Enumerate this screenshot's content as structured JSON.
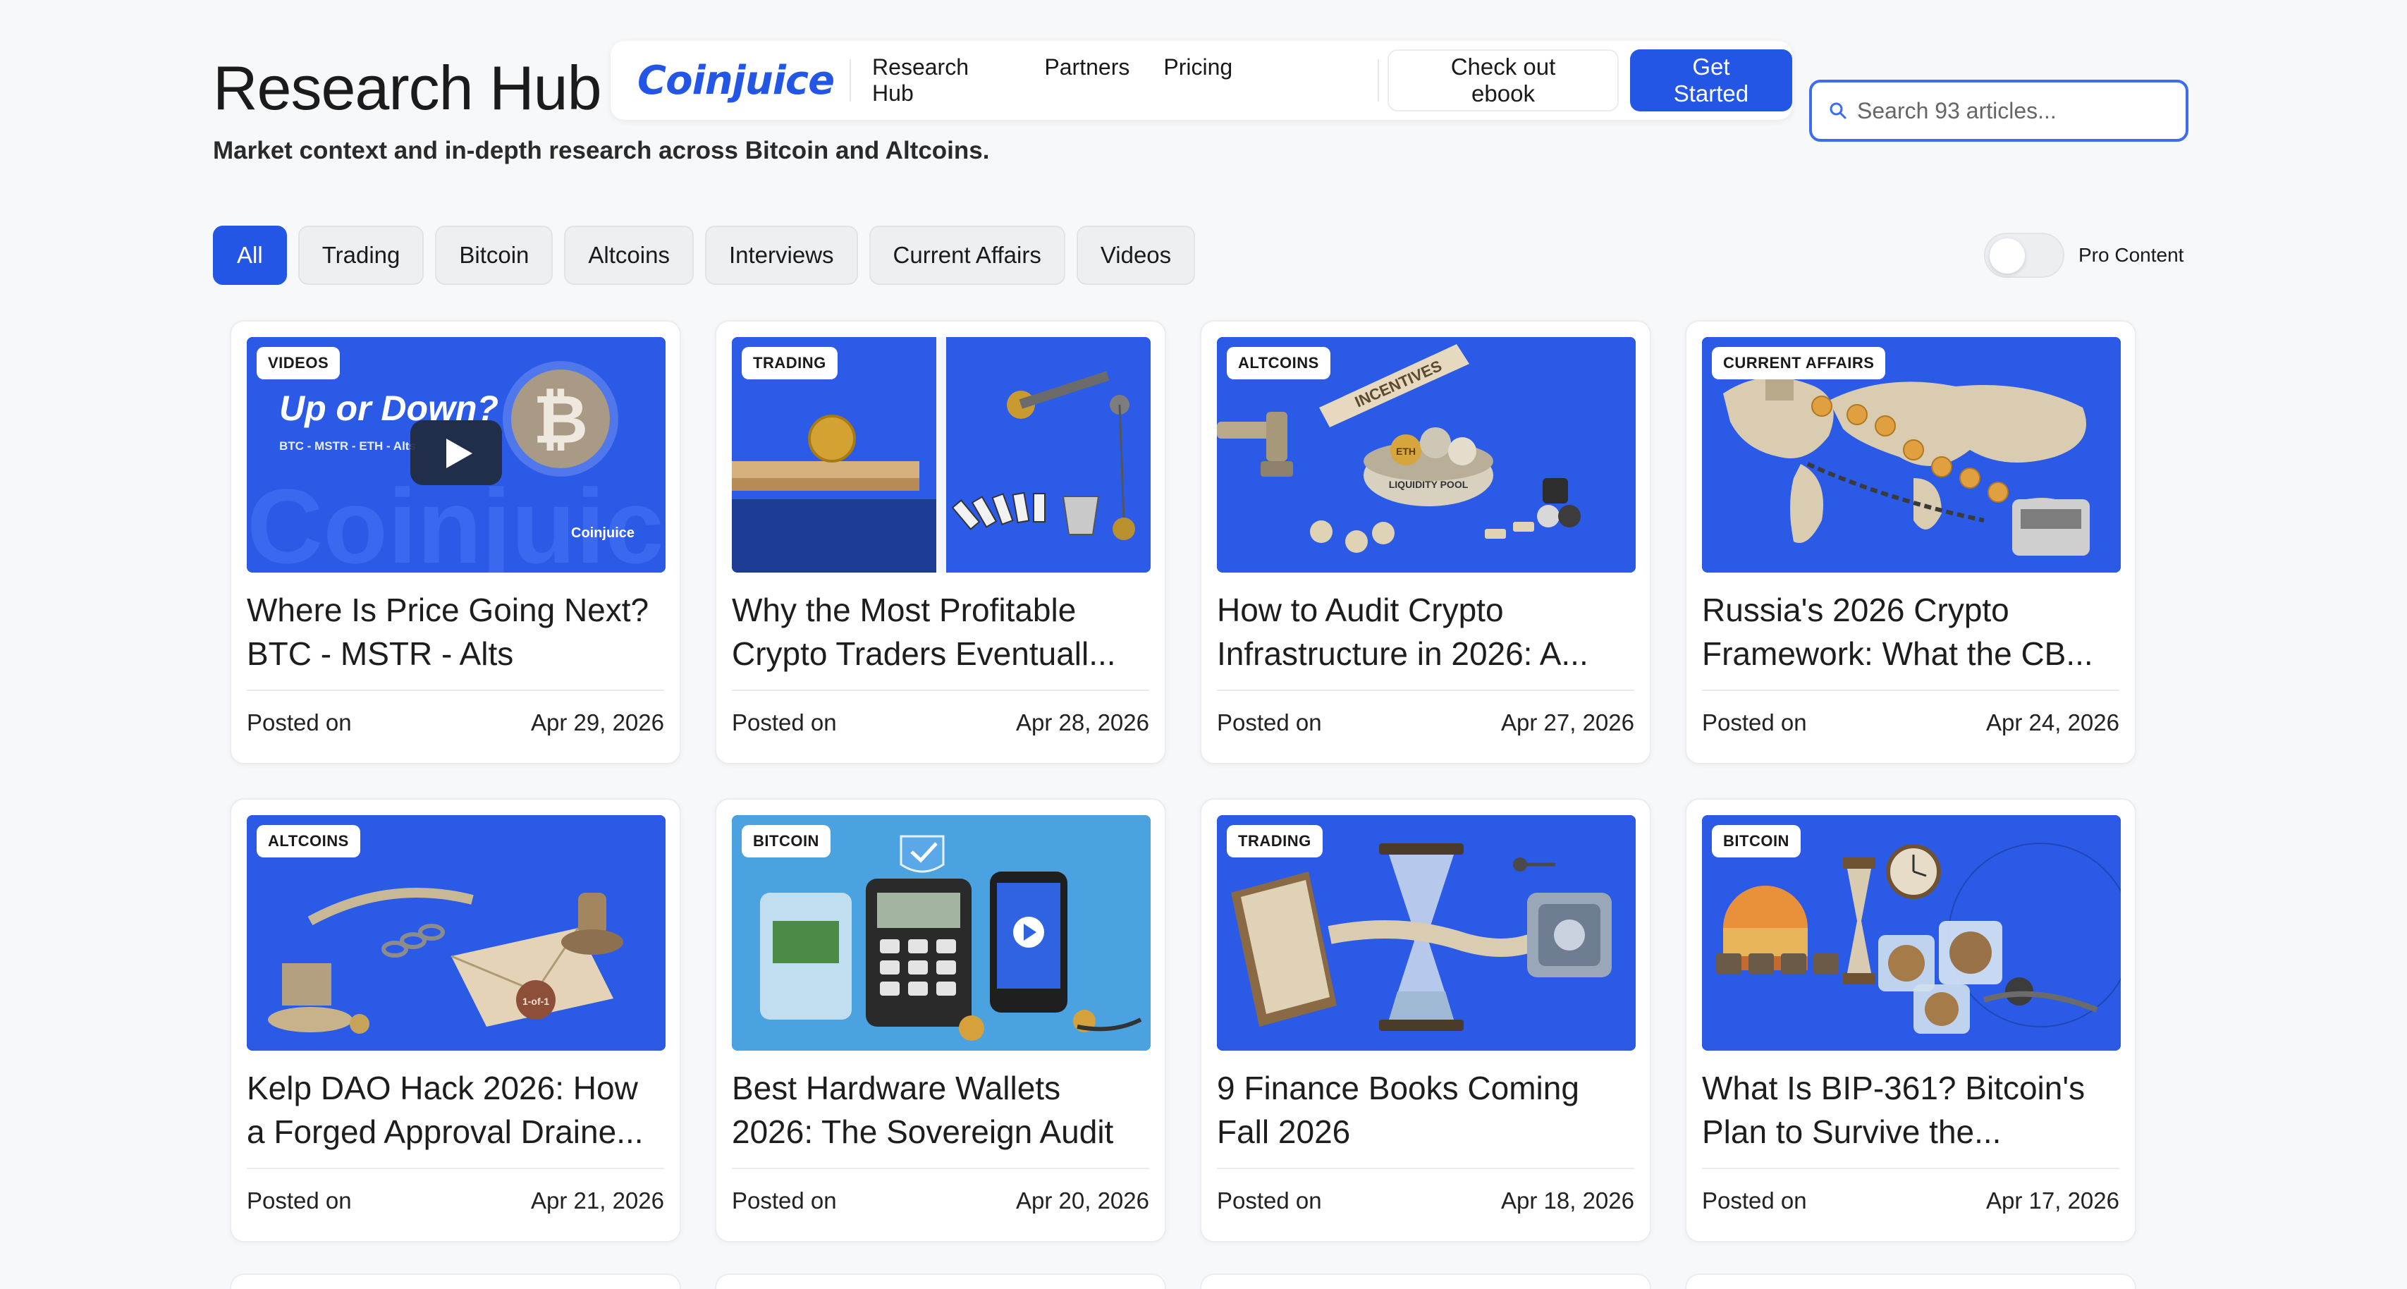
{
  "header": {
    "title": "Research Hub",
    "subtitle": "Market context and in-depth research across Bitcoin and Altcoins."
  },
  "nav": {
    "logo": "Coinjuice",
    "links": [
      "Research Hub",
      "Partners",
      "Pricing"
    ],
    "ebook_label": "Check out ebook",
    "cta_label": "Get Started"
  },
  "search": {
    "placeholder": "Search 93 articles..."
  },
  "filters": {
    "chips": [
      "All",
      "Trading",
      "Bitcoin",
      "Altcoins",
      "Interviews",
      "Current Affairs",
      "Videos"
    ],
    "active": "All",
    "pro_label": "Pro Content"
  },
  "colors": {
    "accent": "#2456e6",
    "thumb_blue": "#2c5be8",
    "thumb_light": "#4aa3e0"
  },
  "articles": [
    {
      "tag": "VIDEOS",
      "title": "Where Is Price Going Next? BTC - MSTR - Alts",
      "posted_label": "Posted on",
      "date": "Apr 29, 2026",
      "thumb_text": "Up or Down?",
      "thumb_sub": "BTC - MSTR - ETH - Alts",
      "thumb_brand": "Coinjuice",
      "thumb_watermark": "Coinjuice",
      "thumb_coin": "₿"
    },
    {
      "tag": "TRADING",
      "title": "Why the Most Profitable Crypto Traders Eventuall...",
      "posted_label": "Posted on",
      "date": "Apr 28, 2026"
    },
    {
      "tag": "ALTCOINS",
      "title": "How to Audit Crypto Infrastructure in 2026: A...",
      "posted_label": "Posted on",
      "date": "Apr 27, 2026",
      "thumb_ribbon": "INCENTIVES",
      "thumb_pool": "LIQUIDITY POOL",
      "thumb_coin": "ETH"
    },
    {
      "tag": "CURRENT AFFAIRS",
      "title": "Russia's 2026 Crypto Framework: What the CB...",
      "posted_label": "Posted on",
      "date": "Apr 24, 2026"
    },
    {
      "tag": "ALTCOINS",
      "title": "Kelp DAO Hack 2026: How a Forged Approval Draine...",
      "posted_label": "Posted on",
      "date": "Apr 21, 2026",
      "thumb_stamp": "1-of-1"
    },
    {
      "tag": "BITCOIN",
      "title": "Best Hardware Wallets 2026: The Sovereign Audit",
      "posted_label": "Posted on",
      "date": "Apr 20, 2026"
    },
    {
      "tag": "TRADING",
      "title": "9 Finance Books Coming Fall 2026",
      "posted_label": "Posted on",
      "date": "Apr 18, 2026"
    },
    {
      "tag": "BITCOIN",
      "title": "What Is BIP-361? Bitcoin's Plan to Survive the...",
      "posted_label": "Posted on",
      "date": "Apr 17, 2026"
    }
  ]
}
